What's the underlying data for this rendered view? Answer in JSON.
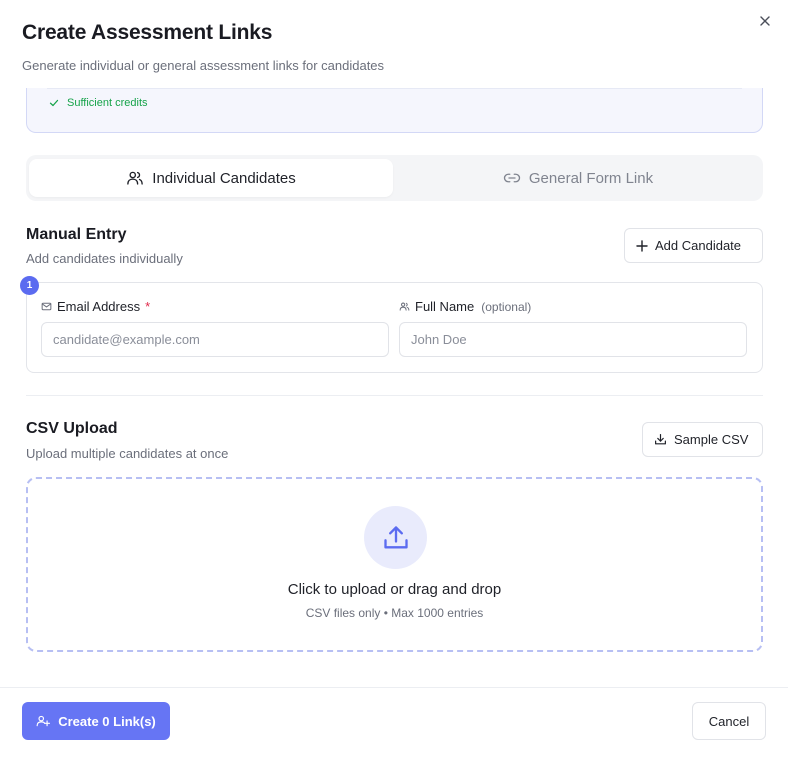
{
  "dialog": {
    "title": "Create Assessment Links",
    "subtitle": "Generate individual or general assessment links for candidates",
    "close_icon": "close-icon"
  },
  "credits": {
    "status_text": "Sufficient credits",
    "status_color": "#16a34a"
  },
  "tabs": [
    {
      "label": "Individual Candidates",
      "icon": "users-icon",
      "active": true
    },
    {
      "label": "General Form Link",
      "icon": "link-icon",
      "active": false
    }
  ],
  "manual_entry": {
    "title": "Manual Entry",
    "subtitle": "Add candidates individually",
    "add_button_label": "Add Candidate",
    "entries": [
      {
        "index": "1",
        "email_label": "Email Address",
        "email_required_mark": "*",
        "email_placeholder": "candidate@example.com",
        "email_value": "",
        "name_label": "Full Name",
        "name_optional": "(optional)",
        "name_placeholder": "John Doe",
        "name_value": ""
      }
    ]
  },
  "csv_upload": {
    "title": "CSV Upload",
    "subtitle": "Upload multiple candidates at once",
    "sample_button_label": "Sample CSV",
    "dropzone_title": "Click to upload or drag and drop",
    "dropzone_subtitle": "CSV files only • Max 1000 entries"
  },
  "footer": {
    "create_button_label": "Create 0 Link(s)",
    "cancel_button_label": "Cancel"
  },
  "colors": {
    "accent": "#6675f4",
    "badge": "#5b6bf0",
    "required": "#e0294a"
  }
}
